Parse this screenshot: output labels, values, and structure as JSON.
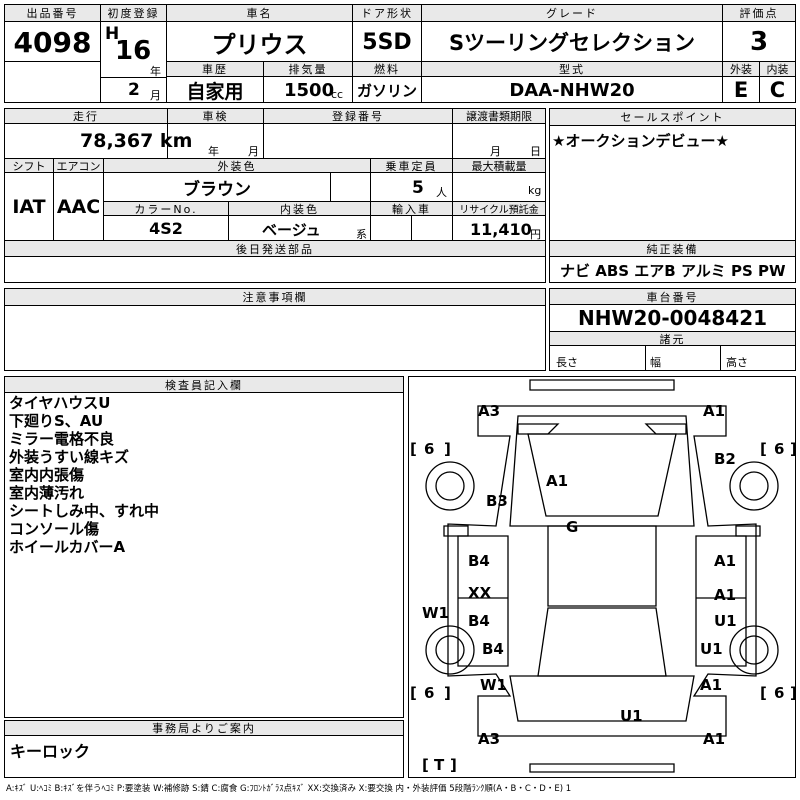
{
  "header": {
    "lot_label": "出品番号",
    "lot_no": "4098",
    "first_reg_label": "初度登録",
    "era": "H",
    "year": "16",
    "year_unit": "年",
    "month": "2",
    "month_unit": "月",
    "car_name_label": "車名",
    "car_name": "プリウス",
    "door_label": "ドア形状",
    "door": "5SD",
    "grade_label": "グレード",
    "grade": "Sツーリングセレクション",
    "score_label": "評価点",
    "score": "3",
    "history_label": "車歴",
    "history": "自家用",
    "displacement_label": "排気量",
    "displacement": "1500",
    "cc_unit": "cc",
    "fuel_label": "燃料",
    "fuel": "ガソリン",
    "model_label": "型式",
    "model": "DAA-NHW20",
    "exterior_label": "外装",
    "exterior": "E",
    "interior_label": "内装",
    "interior": "C"
  },
  "row2": {
    "mileage_label": "走行",
    "mileage": "78,367 km",
    "inspection_label": "車検",
    "insp_year_unit": "年",
    "insp_month_unit": "月",
    "regno_label": "登録番号",
    "transfer_label": "譲渡書類期限",
    "transfer_month_unit": "月",
    "transfer_day_unit": "日",
    "shift_label": "シフト",
    "shift": "IAT",
    "ac_label": "エアコン",
    "ac": "AAC",
    "color_label": "外装色",
    "color": "ブラウン",
    "capacity_label": "乗車定員",
    "capacity": "5",
    "capacity_unit": "人",
    "load_label": "最大積載量",
    "load_unit": "kg",
    "color_no_label": "カラーNo.",
    "color_no": "4S2",
    "int_color_label": "内装色",
    "int_color": "ベージュ",
    "int_color_unit": "系",
    "import_label": "輸入車",
    "recycle_label": "リサイクル預託金",
    "recycle": "11,410",
    "recycle_unit": "円",
    "later_label": "後日発送部品"
  },
  "sales_point": {
    "label": "セールスポイント",
    "text": "★オークションデビュー★"
  },
  "equipment": {
    "label": "純正装備",
    "text": "ナビ ABS エアB アルミ PS PW"
  },
  "caution": {
    "label": "注意事項欄"
  },
  "chassis": {
    "label": "車台番号",
    "number": "NHW20-0048421",
    "dims_label": "諸元",
    "length": "長さ",
    "width": "幅",
    "height": "高さ"
  },
  "inspector": {
    "label": "検査員記入欄",
    "lines": [
      "タイヤハウスU",
      "下廻りS、AU",
      "ミラー電格不良",
      "外装うすい線キズ",
      "室内内張傷",
      "室内薄汚れ",
      "シートしみ中、すれ中",
      "コンソール傷",
      "ホイールカバーA"
    ]
  },
  "office": {
    "label": "事務局よりご案内",
    "text": "キーロック"
  },
  "diagram": {
    "marks": [
      "A3",
      "A1",
      "B2",
      "A1",
      "B3",
      "G",
      "B4",
      "A1",
      "XX",
      "A1",
      "W1",
      "B4",
      "U1",
      "B4",
      "U1",
      "W1",
      "A1",
      "U1",
      "A3",
      "A1"
    ],
    "tire_labels": [
      "6",
      "6",
      "6",
      "6",
      "T"
    ]
  },
  "legend": "A:ｷｽﾞ U:ﾍｺﾐ B:ｷｽﾞを伴うﾍｺﾐ P:要塗装 W:補修跡 S:錆 C:腐食 G:ﾌﾛﾝﾄｶﾞﾗｽ点ｷｽﾞ XX:交換済み X:要交換 内・外装評価 5段階ﾗﾝｸ順(A・B・C・D・E) 1"
}
